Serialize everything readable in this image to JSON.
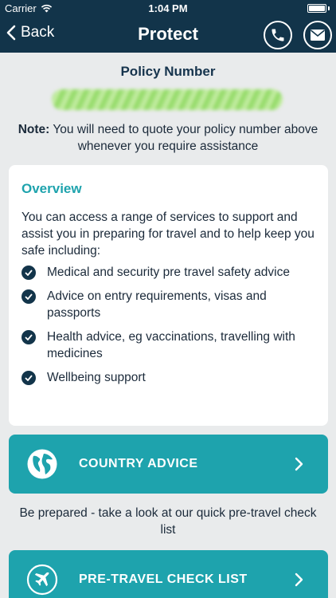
{
  "status_bar": {
    "carrier": "Carrier",
    "time": "1:04 PM"
  },
  "nav": {
    "back_label": "Back",
    "title": "Protect",
    "icons": [
      "phone-icon",
      "mail-icon"
    ]
  },
  "policy": {
    "heading": "Policy Number",
    "note_label": "Note:",
    "note_text": " You will need to quote your policy number above whenever you require assistance"
  },
  "overview": {
    "title": "Overview",
    "intro": "You can access a range of services to support and assist you in preparing for travel and to help keep you safe including:",
    "items": [
      "Medical and security pre travel safety advice",
      "Advice on entry requirements, visas and passports",
      "Health advice, eg vaccinations, travelling with medicines",
      "Wellbeing support"
    ]
  },
  "buttons": {
    "country_advice": "COUNTRY ADVICE",
    "pre_travel": "PRE-TRAVEL CHECK LIST"
  },
  "prepared_text": "Be prepared - take a look at our quick pre-travel check list",
  "colors": {
    "navy": "#12344a",
    "teal": "#1ea3ad",
    "background": "#e9ebec"
  }
}
